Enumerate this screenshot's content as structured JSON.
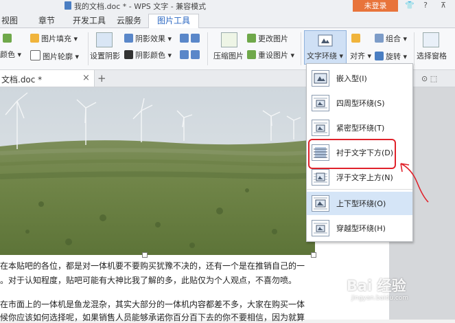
{
  "window": {
    "title": "我的文档.doc * - WPS 文字 - 兼容模式",
    "login_label": "未登录"
  },
  "tabs": [
    {
      "label": "视图"
    },
    {
      "label": "章节"
    },
    {
      "label": "开发工具"
    },
    {
      "label": "云服务"
    },
    {
      "label": "图片工具"
    }
  ],
  "ribbon": {
    "picture_fill": "图片填充",
    "picture_outline": "图片轮廓",
    "color": "颜色",
    "reset_shadow": "设置阴影",
    "shadow_effect": "阴影效果",
    "shadow_color": "阴影颜色",
    "compress": "压缩图片",
    "change_picture": "更改图片",
    "reset_picture": "重设图片",
    "text_wrap": "文字环绕",
    "align": "对齐",
    "group": "组合",
    "rotate": "旋转",
    "selection_pane": "选择窗格"
  },
  "doc_tab": {
    "label": "文档.doc *",
    "close": "×",
    "new": "+"
  },
  "wrap_menu": [
    {
      "label": "嵌入型(I)"
    },
    {
      "label": "四周型环绕(S)"
    },
    {
      "label": "紧密型环绕(T)"
    },
    {
      "label": "衬于文字下方(D)"
    },
    {
      "label": "浮于文字上方(N)"
    },
    {
      "label": "上下型环绕(O)"
    },
    {
      "label": "穿越型环绕(H)"
    }
  ],
  "document": {
    "line1": "在本贴吧的各位，都是对一体机要不要购买犹豫不决的，还有一个是在推销自己的一",
    "line2": "。对于认知程度，贴吧可能有大神比我了解的多，此贴仅为个人观点，不喜勿喷。",
    "line3": "在市面上的一体机是鱼龙混杂，其实大部分的一体机内容都差不多，大家在购买一体",
    "line4": "候你应该如何选择呢，如果销售人员能够承诺你百分百下去的你不要相信，因为就算"
  },
  "watermark": {
    "main": "Bai 经验",
    "sub": "jingyan.baidu.com"
  },
  "colors": {
    "accent": "#2a67c2",
    "login": "#e8743b",
    "annotation": "#e0212a",
    "selected": "#d5e5f7"
  }
}
